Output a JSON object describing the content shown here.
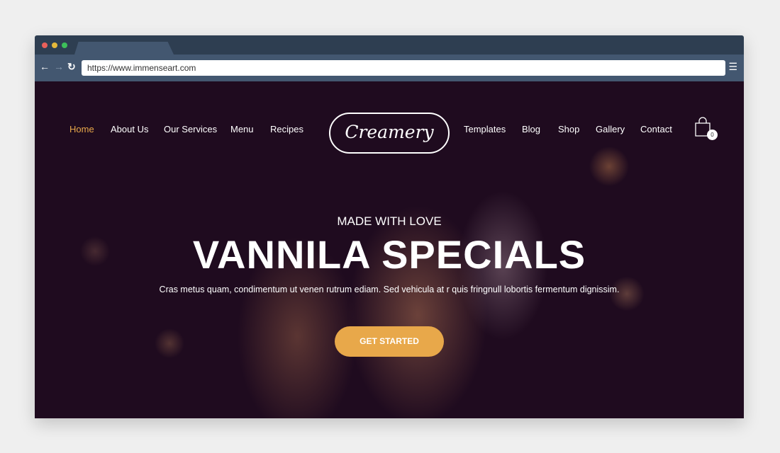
{
  "browser": {
    "url": "https://www.immenseart.com",
    "dots": [
      "#e8605a",
      "#e5b83a",
      "#3dbf5a"
    ]
  },
  "nav": {
    "left": [
      "Home",
      "About Us",
      "Our Services",
      "Menu",
      "Recipes"
    ],
    "right": [
      "Templates",
      "Blog",
      "Shop",
      "Gallery",
      "Contact"
    ],
    "active_color": "#e8a84a"
  },
  "logo": "Creamery",
  "cart": {
    "count": "0",
    "icon": "shopping-bag-icon"
  },
  "hero": {
    "subtitle": "MADE WITH LOVE",
    "title": "VANNILA SPECIALS",
    "description": "Cras metus quam, condimentum ut venen rutrum ediam. Sed vehicula at r quis fringnull lobortis fermentum dignissim.",
    "cta": "GET STARTED",
    "cta_color": "#e8a84a"
  }
}
